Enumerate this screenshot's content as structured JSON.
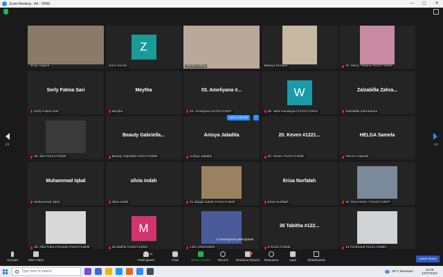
{
  "window": {
    "title": "Zoom Meeting - A4 - VR96",
    "controls": [
      "—",
      "▢",
      "✕"
    ]
  },
  "navigation": {
    "page_left": "1/3",
    "page_right": "1/3"
  },
  "tiles": [
    {
      "label": "Enny Aspara",
      "kind": "video",
      "video_bg": "#8a7a68",
      "muted": false
    },
    {
      "label": "zoom ExA04",
      "kind": "avatar",
      "avatar_letter": "Z",
      "avatar_color": "#1b9a9a",
      "muted": false
    },
    {
      "label": "Henna Yufisa",
      "kind": "video",
      "video_bg": "#b9a99a",
      "muted": false,
      "active": true
    },
    {
      "label": "Marsya Denaus",
      "kind": "video",
      "video_bg": "#c7b8a2",
      "muted": false
    },
    {
      "label": "22. Merry Yohana #1221713022",
      "kind": "video",
      "video_bg": "#c78aa2",
      "muted": true
    },
    {
      "big_name": "Serly Fatma Sari",
      "label": "Serly Fatma Sari",
      "kind": "name",
      "muted": true
    },
    {
      "big_name": "Meytha",
      "label": "Meytha",
      "kind": "name",
      "muted": true
    },
    {
      "big_name": "03. Ameliyana #...",
      "label": "03. Ameliyana #1221713007",
      "kind": "name",
      "muted": true
    },
    {
      "label": "36. Wiwi Handayani #1221713041",
      "kind": "avatar",
      "avatar_letter": "W",
      "avatar_color": "#1b9aa8",
      "muted": true
    },
    {
      "big_name": "Zalzabilla  Zahra...",
      "label": "Zalzabilla Zahrantiara",
      "kind": "name",
      "muted": true
    },
    {
      "label": "09. dea #1221713029",
      "kind": "video",
      "video_bg": "#3a3a3a",
      "muted": true
    },
    {
      "big_name": "Beauty  Gabriella...",
      "label": "Beauty Gabriella #1221713065",
      "kind": "name",
      "muted": true
    },
    {
      "big_name": "Anisya Jaladita",
      "label": "Anisya Jaladita",
      "kind": "name",
      "muted": true
    },
    {
      "big_name": "20. Keven #1221...",
      "label": "20. Keven #1221713030",
      "kind": "name",
      "muted": true
    },
    {
      "big_name": "HELGA Samela",
      "label": "HELGA Samela",
      "kind": "name",
      "muted": true
    },
    {
      "big_name": "Muhammad Iqbal",
      "label": "Muhammad Iqbal",
      "kind": "name",
      "muted": true
    },
    {
      "big_name": "silvia indah",
      "label": "silvia indah",
      "kind": "name",
      "muted": true
    },
    {
      "label": "01.abigail aokah #1221713040",
      "kind": "video",
      "video_bg": "#9a8260",
      "muted": true
    },
    {
      "big_name": "Erisa Nurfalah",
      "label": "Erisa Nurfalah",
      "kind": "name",
      "muted": true
    },
    {
      "label": "10. Dina Resti A #1221713027",
      "kind": "video",
      "video_bg": "#7a8a9a",
      "muted": true
    },
    {
      "label": "28. Oka Putra Firnando #1221713006",
      "kind": "video",
      "video_bg": "#d8d8d8",
      "muted": true
    },
    {
      "label": "26.Mathia #1221713032",
      "kind": "avatar",
      "avatar_letter": "M",
      "avatar_color": "#d2336d",
      "muted": true
    },
    {
      "label": "LISA USMADEW",
      "kind": "video",
      "video_bg": "#4a5a9a",
      "muted": true
    },
    {
      "big_name": "36 Tabitha #122...",
      "label": "a #1221713048",
      "kind": "name",
      "muted": true
    },
    {
      "label": "14.Ferdinand #1221713053",
      "kind": "video",
      "video_bg": "#cfd3d6",
      "muted": true
    }
  ],
  "overlays": {
    "unmute_label": "Ask to Unmute",
    "more_label": "···",
    "unassigned_label": "3 unassigned participants"
  },
  "toolbar": {
    "unmute": "Unmute",
    "start_video": "Start Video",
    "participants": "Participants",
    "participants_count": "36",
    "chat": "Chat",
    "share_screen": "Share Screen",
    "record": "Record",
    "breakout_rooms": "Breakout Rooms",
    "breakout_badge": "1",
    "reactions": "Reactions",
    "apps": "Apps",
    "whiteboards": "Whiteboards",
    "leave": "Leave Room"
  },
  "taskbar": {
    "search_placeholder": "Type here to search",
    "weather": "28°C  Berawan",
    "time": "19:09",
    "date": "12/07/2022",
    "app_colors": [
      "#7a4ad8",
      "#3a6ad8",
      "#f4b400",
      "#1a9af0",
      "#e06a1a",
      "#2d8cff",
      "#4a4a4a"
    ]
  },
  "colors": {
    "accent": "#2d8cff",
    "share": "#23b34a",
    "leave": "#2a57c9",
    "active_outline": "#d8e83c"
  }
}
